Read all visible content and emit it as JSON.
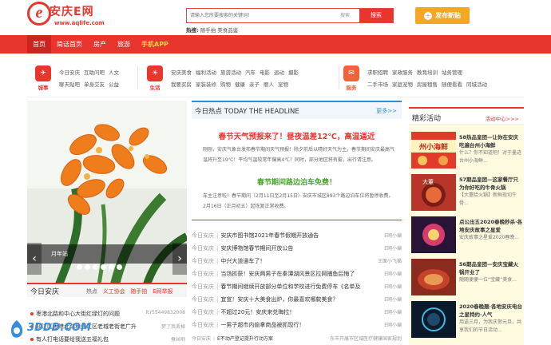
{
  "brand": {
    "name": "安庆E网",
    "url": "www.aqlife.com",
    "accent": "#e8362f"
  },
  "search": {
    "placeholder": "请输入您所要搜索的关键词！",
    "type_label": "搜索",
    "button": "搜索"
  },
  "hot": {
    "label": "热搜:",
    "items": [
      "随手拍",
      "美食品鉴"
    ]
  },
  "publish_button": "发布新贴",
  "nav": [
    {
      "label": "首页",
      "active": true
    },
    {
      "label": "简话首页"
    },
    {
      "label": "房产"
    },
    {
      "label": "旅游"
    },
    {
      "label": "手机APP",
      "highlight": true
    }
  ],
  "categories": [
    {
      "label": "城事",
      "icon": "city-icon",
      "color": "#e8362f",
      "links": [
        "今日安庆",
        "互助问吧",
        "人文",
        "聊天贴吧",
        "单身交友",
        "公益"
      ]
    },
    {
      "label": "生活",
      "icon": "life-icon",
      "color": "#e8362f",
      "links": [
        "安庆美食",
        "福利活动",
        "旅游活动",
        "汽车",
        "电影",
        "运动",
        "摄影",
        "我要买房",
        "家装装修",
        "购物",
        "健康",
        "亲子",
        "丽人",
        "宠物"
      ]
    },
    {
      "label": "服务",
      "icon": "service-icon",
      "color": "#f0623a",
      "links": [
        "求职招聘",
        "家政服务",
        "教育培训",
        "站务管理",
        "二手市场",
        "家庭宠物",
        "房屋租售",
        "随便看看",
        "同城活动"
      ]
    }
  ],
  "slider": {
    "caption": "月年站",
    "dots": 6
  },
  "today_box": {
    "title": "今日安庆",
    "tabs": [
      "热点",
      "义工协会",
      "随手拍",
      "E网举报"
    ],
    "rows": [
      {
        "text": "枣港北路和中心大街红绿灯的问题",
        "right": "lcr55449832008"
      },
      {
        "text": "迎江区枣港北路和迎江区老城老街老广升",
        "right": "梦了我丢掉"
      },
      {
        "text": "有人打电话要给我送五福礼包",
        "right": "蚕丝哟"
      }
    ]
  },
  "headline": {
    "bar_title": "今日热点 TODAY THE HEADLINE",
    "more": "更多>>",
    "story1_title": "春节天气预报来了！昼夜温差12℃，高温逼近",
    "story1_body": "刚刚，安庆气象台发布春节期间天气预报！除夕前后以晴好天气为主，春节期间安庆最高气温将升至19℃！平均气温较常年偏高4℃！同时，部分地区将有雾，出行请注意。",
    "story2_title": "春节期间路边泊车免费！",
    "story2_body": "车主注意啦！春节期间（2月11日至2月15日）安庆市城区893个路边泊车位将暂停收费，2月16日（正月初五）起恢复正常收费。"
  },
  "news": [
    {
      "src": "今日安庆",
      "title": "安庆市图书馆2021年春节假期开放通告",
      "right": "E网小编"
    },
    {
      "src": "今日安庆",
      "title": "安庆博物馆春节期间开放公告",
      "right": "E网小编"
    },
    {
      "src": "今日安庆",
      "title": "中兴大道通车了！",
      "right": "王面小飞猫"
    },
    {
      "src": "今日安庆",
      "title": "当场抓获！安庆两男子在秦潭湖风景区拉网捕鱼后悔了",
      "right": "E网小编"
    },
    {
      "src": "今日安庆",
      "title": "春节期间继续开放部分单位和学校进行免费停车《名单及",
      "right": "E网小编"
    },
    {
      "src": "今日安庆",
      "title": "宜宣！安庆十大美食出炉，你最喜欢哪款美食？",
      "right": "E网小编"
    },
    {
      "src": "今日安庆",
      "title": "不超过20元！安庆来兑晦拉！",
      "right": "E网小编"
    },
    {
      "src": "今日安庆",
      "title": "一男子超市内偷拿商品被抓现行！",
      "right": "E网小编"
    },
    {
      "src": "今日安庆",
      "title": "E不动产登记提升行动方案",
      "right": "东市开展市区域医疗健康国家规划"
    }
  ],
  "featured": {
    "title": "精彩活动",
    "more": "活动中心>>>",
    "cards": [
      {
        "title": "58热品皇团—让你在安庆吃遍台州小海鲜",
        "desc": "什么？你不知道吧！对于墨迹台州小海鲜...",
        "thumb_text": "州小海鲜"
      },
      {
        "title": "57期品皇团—这家餐厅只为你好吃的牛骨火锅",
        "desc": "【大董哈火锅】新鲜现切牛骨...",
        "thumb_text": "大董"
      },
      {
        "title": "点公出五2020春晚秒杀·各地安庆故事之星爱",
        "desc": "安庆故事之星爱2020春晚...",
        "thumb_text": ""
      },
      {
        "title": "56期品皇团—安庆宝藏火锅开业了",
        "desc": "随随便便一位“宝藏”美食...",
        "thumb_text": ""
      },
      {
        "title": "2020春晚题·各地安庆电台之星特约·人气",
        "desc": "用语三月，为我庆贺元旦，共享我们的节日活动...",
        "thumb_text": ""
      }
    ]
  },
  "watermark": "3DDD.COM"
}
